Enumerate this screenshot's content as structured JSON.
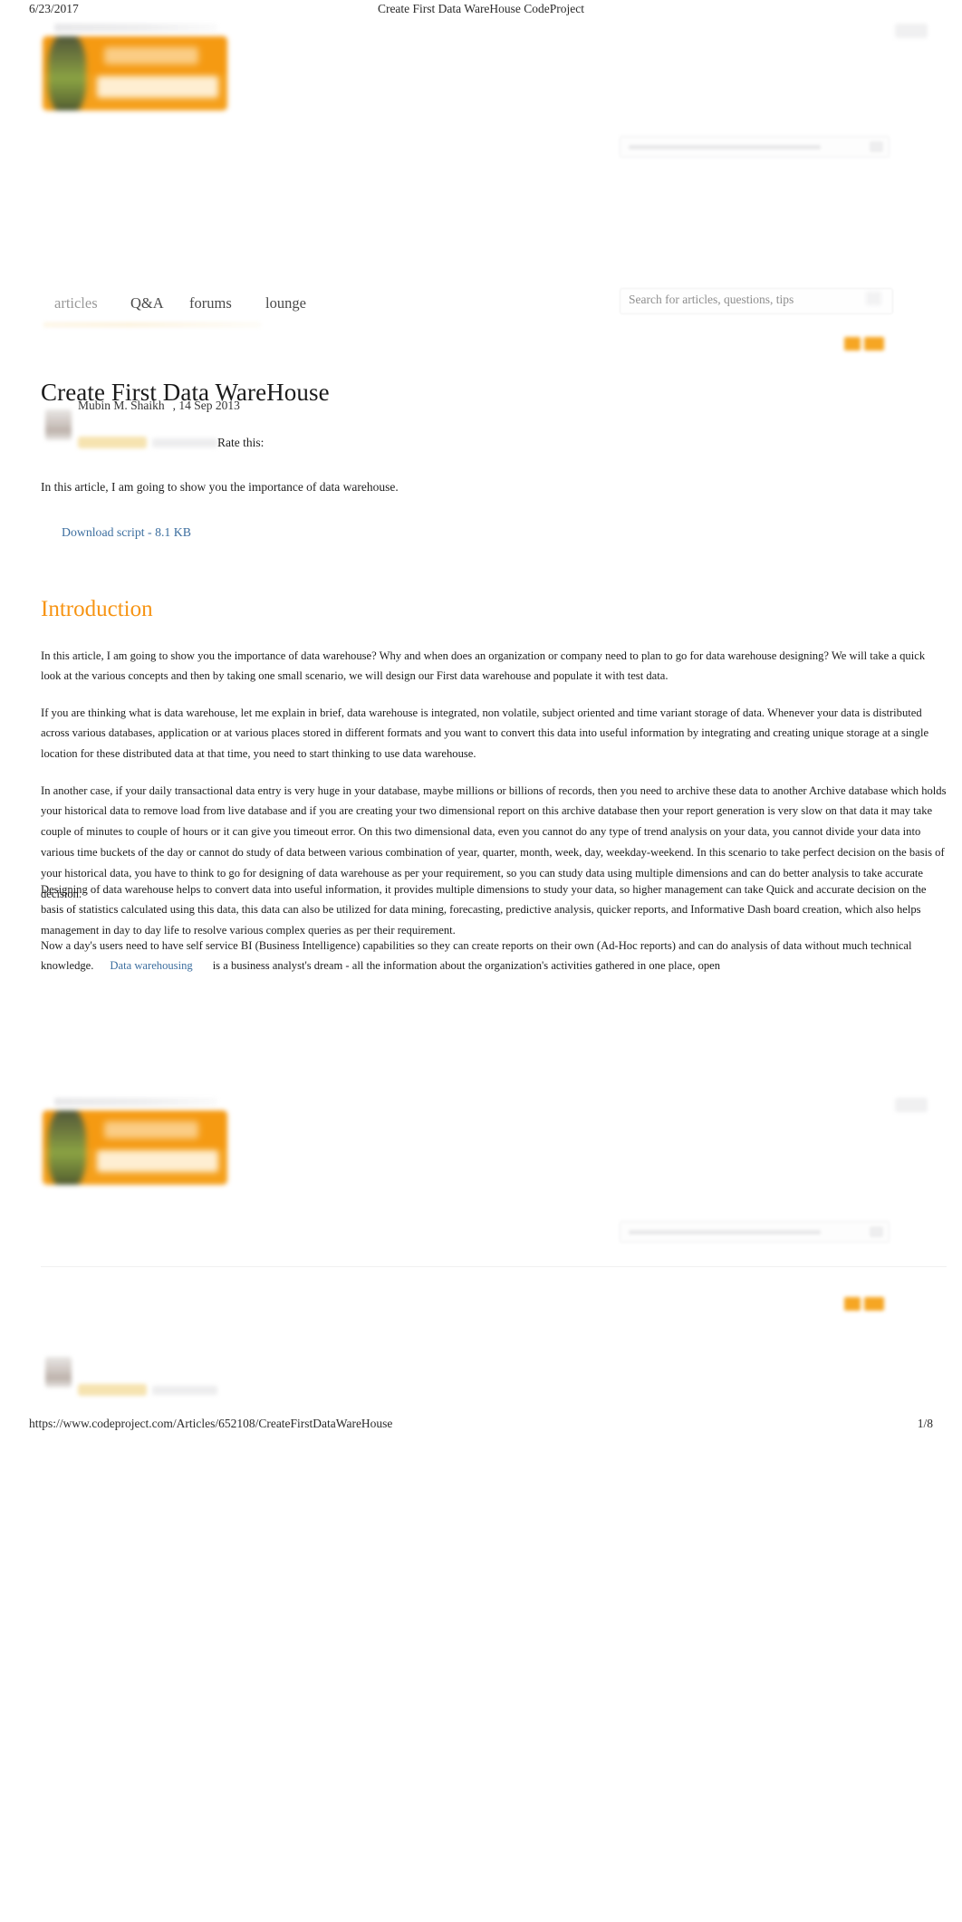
{
  "print_chrome": {
    "date": "6/23/2017",
    "header_title": "Create First Data WareHouse  CodeProject",
    "footer_url": "https://www.codeproject.com/Articles/652108/CreateFirstDataWareHouse",
    "page_number": "1/8"
  },
  "site": {
    "logo_alt": "The Code Project",
    "nav": [
      {
        "label": "articles",
        "state": "active"
      },
      {
        "label": "Q&A",
        "state": "normal"
      },
      {
        "label": "forums",
        "state": "normal"
      },
      {
        "label": "lounge",
        "state": "normal"
      }
    ],
    "search": {
      "placeholder": "Search for articles, questions, tips",
      "value": "",
      "icon": "search-icon"
    }
  },
  "article": {
    "title": "Create First Data WareHouse",
    "author": "Mubin M. Shaikh",
    "date": ", 14 Sep 2013",
    "rate_label": "Rate this:",
    "lede": "In this article, I am going to show you the importance of data warehouse.",
    "download_link": "Download script - 8.1 KB",
    "section_heading": "Introduction",
    "paragraphs": [
      "In this article, I am going to show you the importance of data warehouse? Why and when does an organization or company need to plan to go for data warehouse designing? We will take a quick look at the various concepts and then by taking one small scenario, we will design our First data warehouse and populate it with test data.",
      "If you are thinking what is data warehouse, let me explain in brief, data warehouse is integrated, non volatile, subject oriented and time variant storage of data. Whenever your data is distributed across various databases, application or at various places stored in different formats and you want to convert this data into useful information by integrating and creating unique storage at a single location for these distributed data at that time, you need to start thinking to use data warehouse.",
      "In another case, if your daily transactional data entry is very huge in your database, maybe millions or billions of records, then you need to archive these data to another Archive database which holds your historical data to remove load from live database and if you are creating your two dimensional report on this archive database then your report generation is very slow on that data it may take couple of minutes to couple of hours or it can give you timeout error. On this two dimensional data, even you cannot do any type of trend analysis on your data, you cannot divide your data into various time buckets of the day or cannot do study of data between various combination of year, quarter, month, week, day, weekday-weekend. In this scenario to take perfect decision on the basis of your historical data, you have to think to go for designing of data warehouse as per your requirement, so you can study data using multiple dimensions and can do better analysis to take accurate decision.",
      "Designing of data warehouse helps to convert data into useful information, it provides multiple dimensions to study your data, so higher management can take Quick and accurate decision on the basis of statistics calculated using this data, this data can also be utilized for data mining, forecasting, predictive analysis, quicker reports, and Informative Dash board creation, which also helps management in day to day life to resolve various complex queries as per their requirement."
    ],
    "last_paragraph": {
      "before": "Now a day's users need to have self service BI (Business Intelligence) capabilities so they can create reports on their own (Ad-Hoc reports) and can do analysis of data without much technical knowledge.",
      "link": "Data warehousing",
      "after": "is a business analyst's dream - all the information about the organization's activities gathered in one place, open"
    }
  },
  "colors": {
    "brand_orange": "#f79413",
    "logo_orange": "#f5a01b",
    "link_blue": "#3c6e9f",
    "text": "#1b1b1b",
    "muted": "#9a9a9a"
  }
}
